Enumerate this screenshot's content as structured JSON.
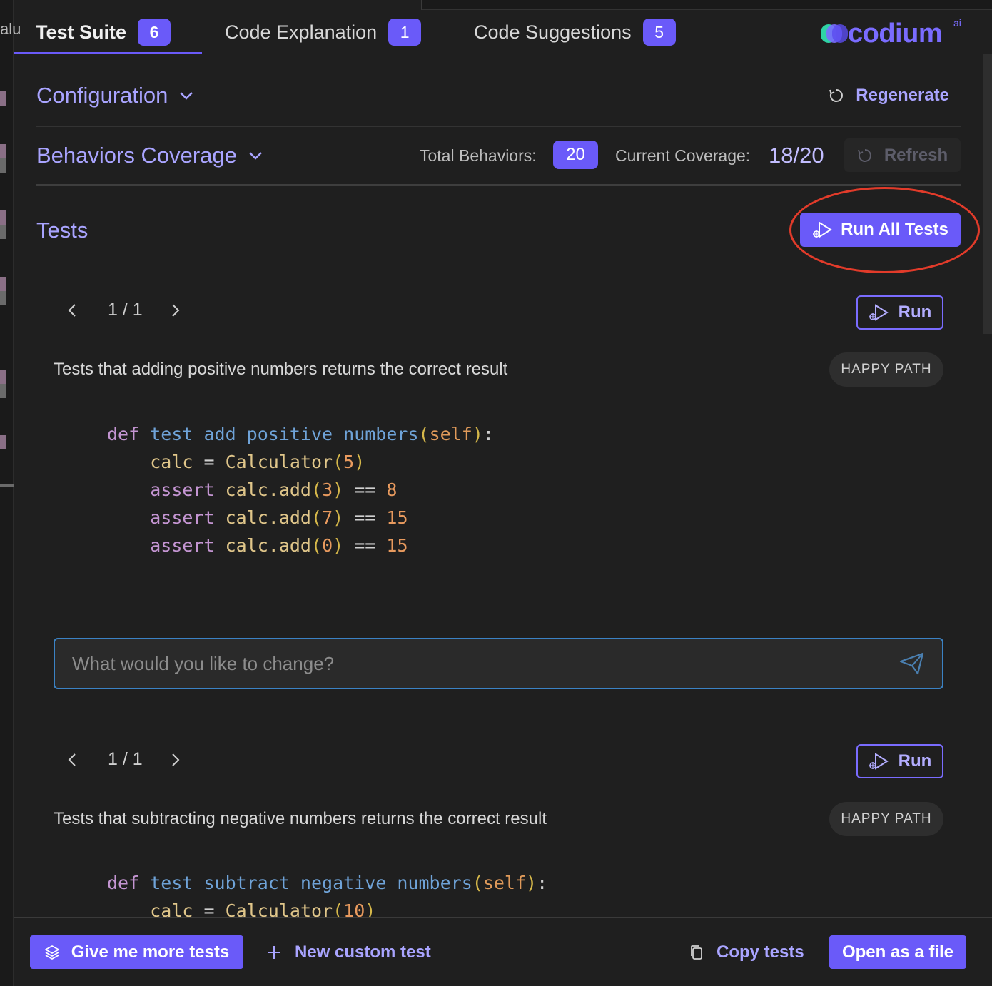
{
  "left_strip": {
    "text": "alu"
  },
  "tabs": [
    {
      "label": "Test Suite",
      "count": "6"
    },
    {
      "label": "Code Explanation",
      "count": "1"
    },
    {
      "label": "Code Suggestions",
      "count": "5"
    }
  ],
  "logo": {
    "text": "codium",
    "ai": "ai"
  },
  "configuration": {
    "title": "Configuration",
    "regenerate_label": "Regenerate"
  },
  "coverage": {
    "title": "Behaviors Coverage",
    "total_label": "Total Behaviors:",
    "total_value": "20",
    "current_label": "Current Coverage:",
    "current_value": "18/20",
    "refresh_label": "Refresh"
  },
  "tests_section": {
    "title": "Tests",
    "run_all_label": "Run All Tests"
  },
  "tests": [
    {
      "pager": "1 / 1",
      "run_label": "Run",
      "description": "Tests that adding positive numbers returns the correct result",
      "tag": "HAPPY PATH",
      "code": {
        "def_kw": "def",
        "fn_name": "test_add_positive_numbers",
        "param": "self",
        "lines": [
          {
            "kw": "",
            "id": "calc",
            "op": " = ",
            "call": "Calculator",
            "arg": "5",
            "num": ""
          },
          {
            "kw": "assert ",
            "id": "calc.add",
            "op": "",
            "call": "",
            "arg": "3",
            "num": "8"
          },
          {
            "kw": "assert ",
            "id": "calc.add",
            "op": "",
            "call": "",
            "arg": "7",
            "num": "15"
          },
          {
            "kw": "assert ",
            "id": "calc.add",
            "op": "",
            "call": "",
            "arg": "0",
            "num": "15"
          }
        ]
      }
    },
    {
      "pager": "1 / 1",
      "run_label": "Run",
      "description": "Tests that subtracting negative numbers returns the correct result",
      "tag": "HAPPY PATH",
      "code": {
        "def_kw": "def",
        "fn_name": "test_subtract_negative_numbers",
        "param": "self",
        "lines": [
          {
            "kw": "",
            "id": "calc",
            "op": " = ",
            "call": "Calculator",
            "arg": "10",
            "num": ""
          }
        ]
      }
    }
  ],
  "change_input": {
    "placeholder": "What would you like to change?",
    "value": ""
  },
  "bottom": {
    "more_tests_label": "Give me more tests",
    "custom_test_label": "New custom test",
    "copy_label": "Copy tests",
    "open_file_label": "Open as a file"
  },
  "colors": {
    "accent": "#6a5af9",
    "accent_text": "#a9a4ff",
    "annotation": "#e23b2a",
    "input_border": "#3b82c4"
  }
}
